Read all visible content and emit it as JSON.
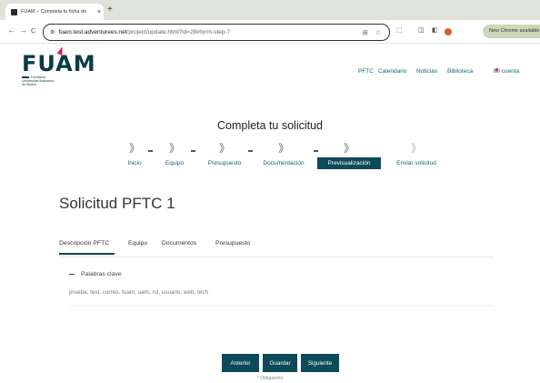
{
  "browser": {
    "tab_title": "FUAM – Completa tu ficha de",
    "tab_close": "×",
    "new_tab": "+",
    "back": "←",
    "forward": "→",
    "reload": "C",
    "url_host": "fuam.test.adventurees.net",
    "url_path": "/project/update.html?id=28#form-step-7",
    "update_label": "New Chrome available"
  },
  "header": {
    "logo_text": "FUAM",
    "logo_subtitle": "Fundación Universidad Autónoma de Madrid",
    "nav": [
      "PFTC",
      "Calendario",
      "Noticias",
      "Biblioteca"
    ],
    "account": "Mi cuenta"
  },
  "form": {
    "title": "Completa tu solicitud",
    "steps": [
      {
        "label": "Inicio",
        "state": "done"
      },
      {
        "label": "Equipo",
        "state": "done"
      },
      {
        "label": "Presupuesto",
        "state": "done"
      },
      {
        "label": "Documentación",
        "state": "done"
      },
      {
        "label": "Previsualización",
        "state": "active"
      },
      {
        "label": "Enviar solicitud",
        "state": "pending"
      }
    ],
    "step_icon": "》"
  },
  "solicitud": {
    "title": "Solicitud PFTC 1",
    "tabs": [
      "Descripción PFTC",
      "Equipo",
      "Documentos",
      "Presupuesto"
    ],
    "section_heading": "Palabras clave",
    "keywords": "prueba, test, correo, fuam, uam, rol, usuario, web, tech"
  },
  "buttons": {
    "prev": "Anterior",
    "save": "Guardar",
    "next": "Siguiente"
  },
  "required_note": "* Obligatorio",
  "colors": {
    "brand_dark": "#0d4a5a",
    "link": "#17607a",
    "accent_red": "#e0174b"
  }
}
